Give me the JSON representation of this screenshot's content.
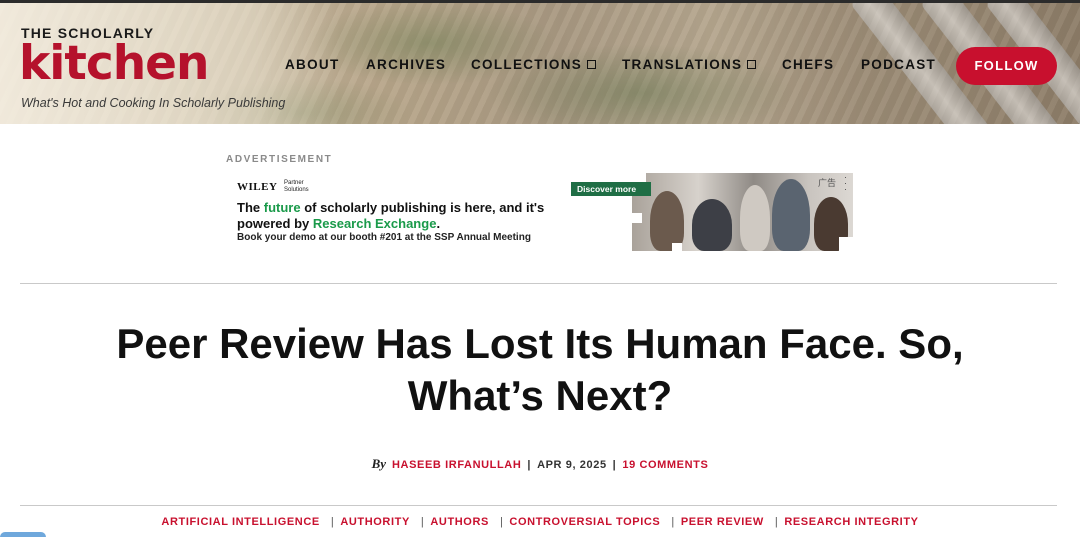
{
  "site": {
    "logo_top": "THE SCHOLARLY",
    "logo_main": "kitchen",
    "tagline": "What's Hot and Cooking In Scholarly Publishing"
  },
  "nav": {
    "items": [
      {
        "label": "ABOUT",
        "has_dropdown": false
      },
      {
        "label": "ARCHIVES",
        "has_dropdown": false
      },
      {
        "label": "COLLECTIONS",
        "has_dropdown": true
      },
      {
        "label": "TRANSLATIONS",
        "has_dropdown": true
      },
      {
        "label": "CHEFS",
        "has_dropdown": false
      },
      {
        "label": "PODCAST",
        "has_dropdown": false
      }
    ],
    "follow_label": "FOLLOW"
  },
  "ad": {
    "label": "ADVERTISEMENT",
    "brand": "WILEY",
    "brand_sub_1": "Partner",
    "brand_sub_2": "Solutions",
    "headline_1": "The ",
    "headline_2": "future",
    "headline_3": " of scholarly publishing is here, and it's powered by ",
    "headline_4": "Research Exchange",
    "headline_5": ".",
    "subline": "Book your demo at our booth #201 at the SSP Annual Meeting",
    "cta": "Discover more",
    "tag": "广告"
  },
  "article": {
    "title": "Peer Review Has Lost Its Human Face. So, What’s Next?",
    "by": "By",
    "author": "HASEEB IRFANULLAH",
    "date": "APR 9, 2025",
    "comments": "19 COMMENTS",
    "tags": [
      "ARTIFICIAL INTELLIGENCE",
      "AUTHORITY",
      "AUTHORS",
      "CONTROVERSIAL TOPICS",
      "PEER REVIEW",
      "RESEARCH INTEGRITY"
    ]
  },
  "colors": {
    "brand_red": "#c8102e",
    "ad_green": "#1a9a4a"
  }
}
